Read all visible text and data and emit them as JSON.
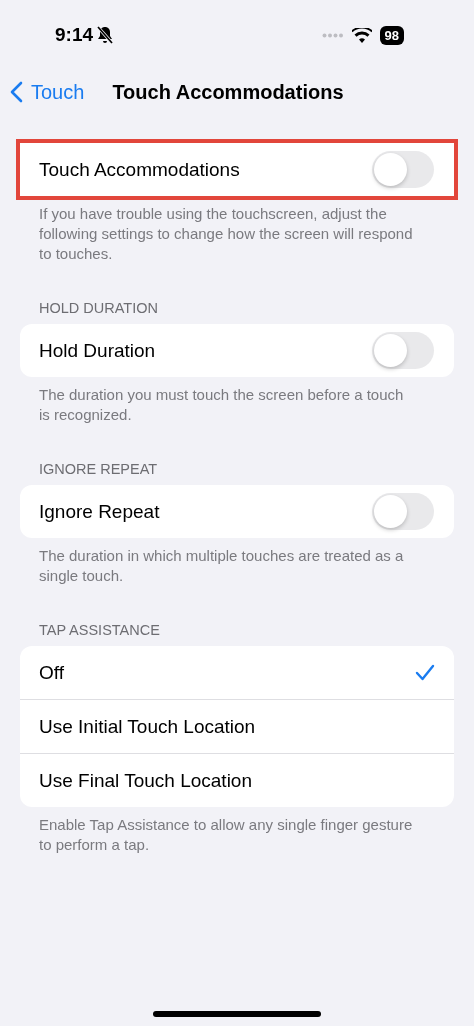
{
  "status_bar": {
    "time": "9:14",
    "silent": true,
    "battery": "98"
  },
  "nav": {
    "back": "Touch",
    "title": "Touch Accommodations"
  },
  "sections": [
    {
      "highlighted": true,
      "rows": [
        {
          "kind": "toggle",
          "label": "Touch Accommodations",
          "on": false
        }
      ],
      "footer": "If you have trouble using the touchscreen, adjust the following settings to change how the screen will respond to touches."
    },
    {
      "highlighted": false,
      "header": "HOLD DURATION",
      "rows": [
        {
          "kind": "toggle",
          "label": "Hold Duration",
          "on": false
        }
      ],
      "footer": "The duration you must touch the screen before a touch is recognized."
    },
    {
      "highlighted": false,
      "header": "IGNORE REPEAT",
      "rows": [
        {
          "kind": "toggle",
          "label": "Ignore Repeat",
          "on": false
        }
      ],
      "footer": "The duration in which multiple touches are treated as a single touch."
    },
    {
      "highlighted": false,
      "header": "TAP ASSISTANCE",
      "rows": [
        {
          "kind": "option",
          "label": "Off",
          "selected": true
        },
        {
          "kind": "option",
          "label": "Use Initial Touch Location",
          "selected": false
        },
        {
          "kind": "option",
          "label": "Use Final Touch Location",
          "selected": false
        }
      ],
      "footer": "Enable Tap Assistance to allow any single finger gesture to perform a tap."
    }
  ]
}
